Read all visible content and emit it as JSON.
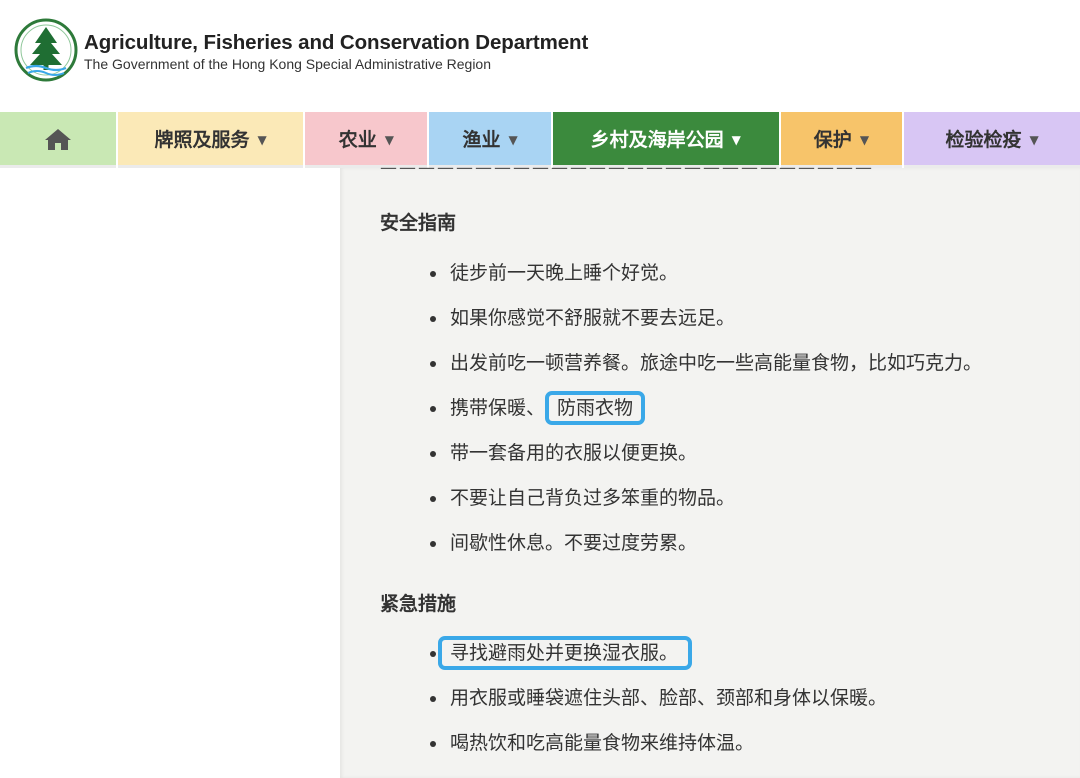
{
  "header": {
    "title": "Agriculture, Fisheries and Conservation Department",
    "subtitle": "The Government of the Hong Kong Special Administrative Region"
  },
  "nav": {
    "items": [
      {
        "label": "",
        "icon": "home-icon",
        "color": "#c9e8b4",
        "width": 116
      },
      {
        "label": "牌照及服务",
        "color": "#fbe9b7",
        "width": 186
      },
      {
        "label": "农业",
        "color": "#f7c7cc",
        "width": 122
      },
      {
        "label": "渔业",
        "color": "#a9d4f3",
        "width": 122
      },
      {
        "label": "乡村及海岸公园",
        "color": "#3b8a3d",
        "width": 226,
        "active": true
      },
      {
        "label": "保护",
        "color": "#f7c46a",
        "width": 122
      },
      {
        "label": "检验检疫",
        "color": "#d8c6f4",
        "width": 176
      }
    ]
  },
  "content": {
    "cut_text": "——————————————————————————",
    "sections": [
      {
        "heading": "安全指南",
        "items": [
          "徒步前一天晚上睡个好觉。",
          "如果你感觉不舒服就不要去远足。",
          "出发前吃一顿营养餐。旅途中吃一些高能量食物，比如巧克力。",
          "携带保暖、",
          "带一套备用的衣服以便更换。",
          "不要让自己背负过多笨重的物品。",
          "间歇性休息。不要过度劳累。"
        ],
        "highlight_suffix": "防雨衣物"
      },
      {
        "heading": "紧急措施",
        "items": [
          "寻找避雨处并更换湿衣服。",
          "用衣服或睡袋遮住头部、脸部、颈部和身体以保暖。",
          "喝热饮和吃高能量食物来维持体温。"
        ]
      }
    ]
  },
  "colors": {
    "highlight_border": "#3aa8e8",
    "content_bg": "#f3f3f1"
  }
}
